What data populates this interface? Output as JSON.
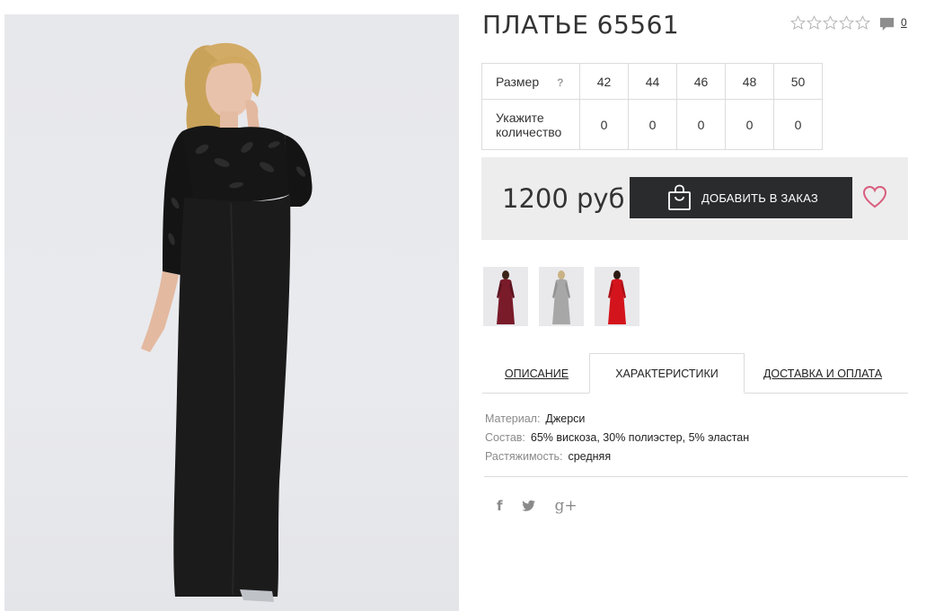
{
  "product": {
    "title": "ПЛАТЬЕ 65561",
    "rating_stars": 0,
    "rating_max": 5,
    "comments_count": "0",
    "price": "1200 руб",
    "add_button_label": "ДОБАВИТЬ В ЗАКАЗ"
  },
  "size_table": {
    "size_label": "Размер",
    "help_mark": "?",
    "qty_label_line1": "Укажите",
    "qty_label_line2": "количество",
    "sizes": [
      "42",
      "44",
      "46",
      "48",
      "50"
    ],
    "quantities": [
      "0",
      "0",
      "0",
      "0",
      "0"
    ]
  },
  "thumbnails": [
    {
      "color": "#7a1b2a"
    },
    {
      "color": "#a7a7a7"
    },
    {
      "color": "#d4141c"
    }
  ],
  "tabs": [
    {
      "label": "ОПИСАНИЕ"
    },
    {
      "label": "ХАРАКТЕРИСТИКИ"
    },
    {
      "label": "ДОСТАВКА И ОПЛАТА"
    }
  ],
  "specs": [
    {
      "label": "Материал:",
      "value": "Джерси"
    },
    {
      "label": "Состав:",
      "value": "65% вискоза, 30% полиэстер, 5% эластан"
    },
    {
      "label": "Растяжимость:",
      "value": "средняя"
    }
  ],
  "social": {
    "facebook": "f",
    "twitter": "🐦",
    "googleplus": "g+"
  },
  "colors": {
    "button_bg": "#2a2b2c",
    "buy_box_bg": "#ededed",
    "heart": "#d95d7e",
    "border": "#dcdcdc"
  }
}
